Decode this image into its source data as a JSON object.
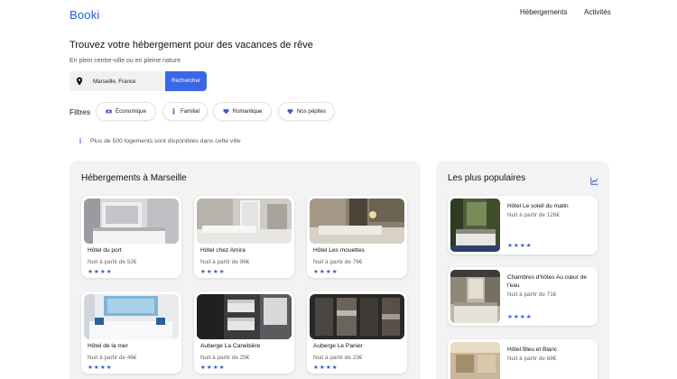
{
  "header": {
    "logo": "Booki",
    "nav": [
      "Hébergements",
      "Activités"
    ]
  },
  "hero": {
    "title": "Trouvez votre hébergement pour des vacances de rêve",
    "subtitle": "En plein centre-ville ou en pleine nature",
    "search_value": "Marseille, France",
    "search_button": "Rechercher"
  },
  "filters": {
    "label": "Filtres",
    "chips": [
      "Économique",
      "Familial",
      "Romantique",
      "Nos pépites"
    ]
  },
  "info": {
    "icon": "info-icon",
    "text": "Plus de 500 logements sont disponibles dans cette ville"
  },
  "listings": {
    "title": "Hébergements à Marseille",
    "items": [
      {
        "name": "Hôtel du port",
        "price": "Nuit à partir de 52€",
        "stars": "★★★★"
      },
      {
        "name": "Hôtel chez Amira",
        "price": "Nuit à partir de 96€",
        "stars": "★★★★"
      },
      {
        "name": "Hôtel Les mouettes",
        "price": "Nuit à partir de 76€",
        "stars": "★★★★"
      },
      {
        "name": "Hôtel de la mer",
        "price": "Nuit à partir de 46€",
        "stars": "★★★★"
      },
      {
        "name": "Auberge La Canebière",
        "price": "Nuit à partir de 25€",
        "stars": "★★★★"
      },
      {
        "name": "Auberge Le Panier",
        "price": "Nuit à partir de 23€",
        "stars": "★★★★"
      }
    ]
  },
  "popular": {
    "title": "Les plus populaires",
    "icon": "trend-chart-icon",
    "items": [
      {
        "name": "Hôtel Le soleil du matin",
        "price": "Nuit à partir de 128€",
        "stars": "★★★★"
      },
      {
        "name": "Chambres d'hôtes Au cœur de l'eau",
        "price": "Nuit à partir de 71€",
        "stars": "★★★★"
      },
      {
        "name": "Hôtel Bleu et Blanc",
        "price": "Nuit à partir de 68€",
        "stars": ""
      }
    ]
  },
  "colors": {
    "brand": "#1f5fd8",
    "button": "#3b66e6",
    "stars": "#3b5bd6",
    "panel_bg": "#f3f3f3"
  }
}
